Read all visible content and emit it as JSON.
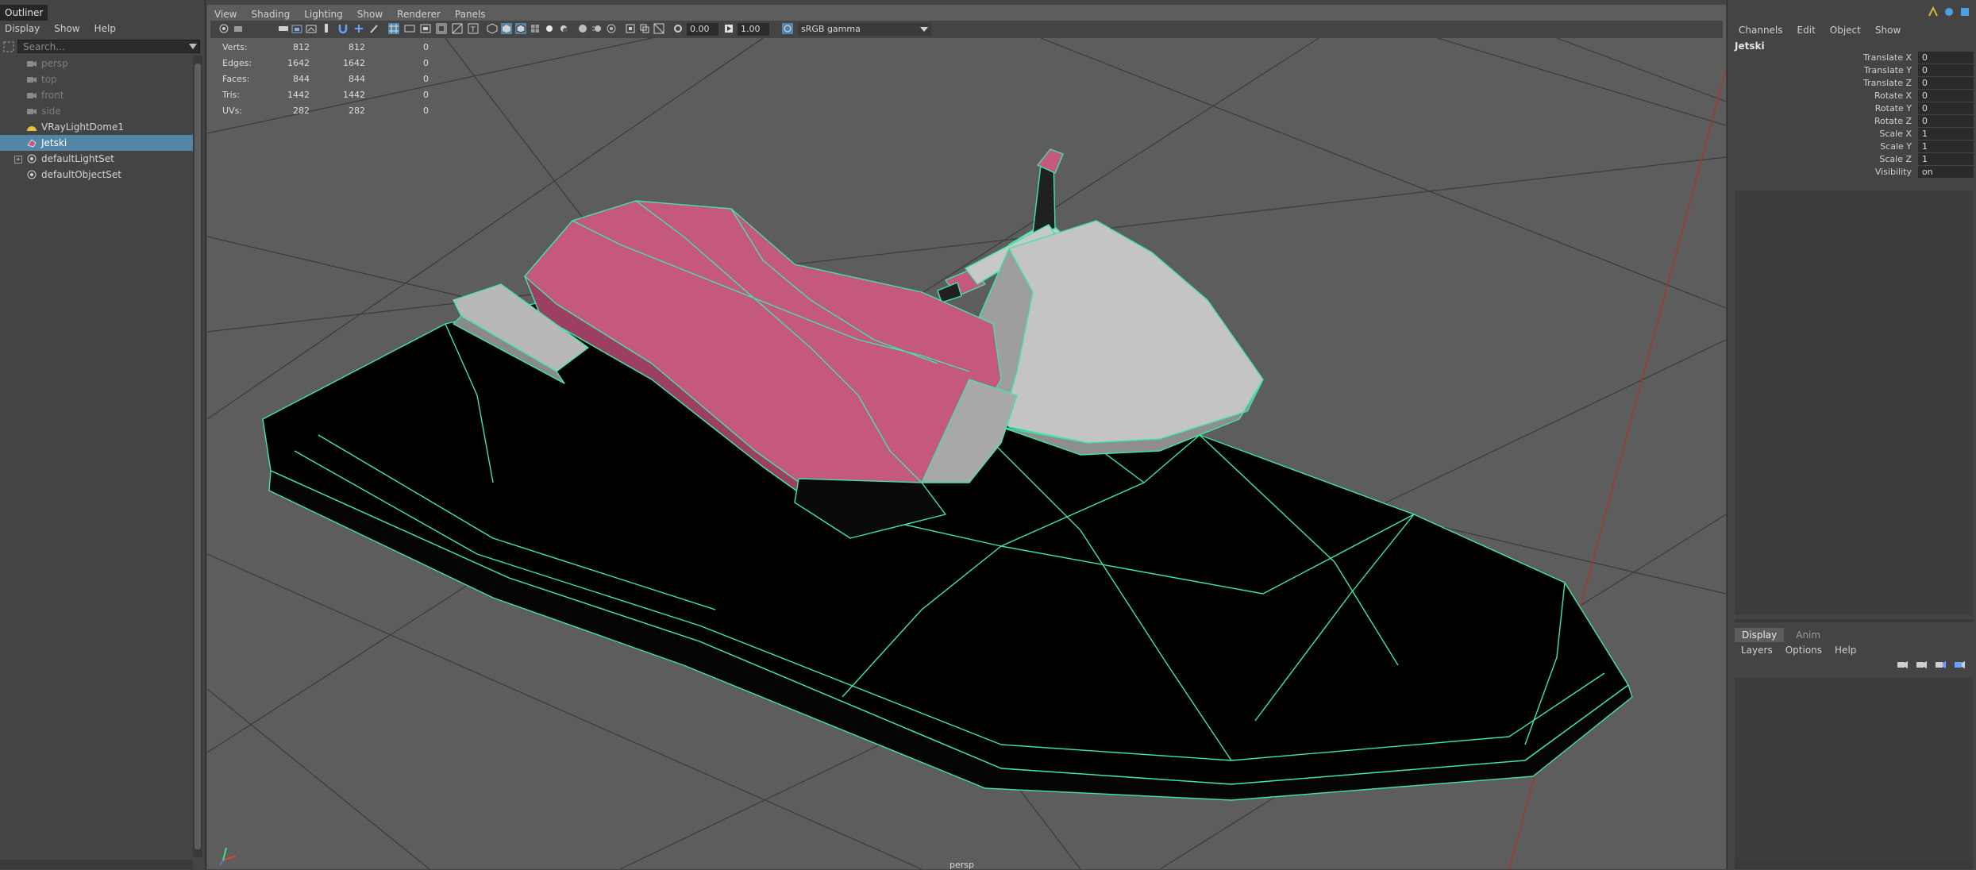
{
  "outliner": {
    "tab_title": "Outliner",
    "menu": [
      "Display",
      "Show",
      "Help"
    ],
    "search_placeholder": "Search...",
    "items": [
      {
        "label": "persp",
        "icon": "camera-icon",
        "dim": true,
        "selected": false
      },
      {
        "label": "top",
        "icon": "camera-icon",
        "dim": true,
        "selected": false
      },
      {
        "label": "front",
        "icon": "camera-icon",
        "dim": true,
        "selected": false
      },
      {
        "label": "side",
        "icon": "camera-icon",
        "dim": true,
        "selected": false
      },
      {
        "label": "VRayLightDome1",
        "icon": "dome-light-icon",
        "dim": false,
        "selected": false
      },
      {
        "label": "Jetski",
        "icon": "mesh-icon",
        "dim": false,
        "selected": true
      },
      {
        "label": "defaultLightSet",
        "icon": "set-icon",
        "dim": false,
        "selected": false,
        "expandable": true
      },
      {
        "label": "defaultObjectSet",
        "icon": "set-icon",
        "dim": false,
        "selected": false
      }
    ]
  },
  "viewport": {
    "menu": [
      "View",
      "Shading",
      "Lighting",
      "Show",
      "Renderer",
      "Panels"
    ],
    "toolbar": {
      "exposure": "0.00",
      "gamma": "1.00",
      "color_space": "sRGB gamma"
    },
    "hud": [
      {
        "label": "Verts:",
        "v1": "812",
        "v2": "812",
        "v3": "0"
      },
      {
        "label": "Edges:",
        "v1": "1642",
        "v2": "1642",
        "v3": "0"
      },
      {
        "label": "Faces:",
        "v1": "844",
        "v2": "844",
        "v3": "0"
      },
      {
        "label": "Tris:",
        "v1": "1442",
        "v2": "1442",
        "v3": "0"
      },
      {
        "label": "UVs:",
        "v1": "282",
        "v2": "282",
        "v3": "0"
      }
    ],
    "camera_label": "persp"
  },
  "channel_box": {
    "menu": [
      "Channels",
      "Edit",
      "Object",
      "Show"
    ],
    "object_name": "Jetski",
    "channels": [
      {
        "name": "Translate X",
        "value": "0"
      },
      {
        "name": "Translate Y",
        "value": "0"
      },
      {
        "name": "Translate Z",
        "value": "0"
      },
      {
        "name": "Rotate X",
        "value": "0"
      },
      {
        "name": "Rotate Y",
        "value": "0"
      },
      {
        "name": "Rotate Z",
        "value": "0"
      },
      {
        "name": "Scale X",
        "value": "1"
      },
      {
        "name": "Scale Y",
        "value": "1"
      },
      {
        "name": "Scale Z",
        "value": "1"
      },
      {
        "name": "Visibility",
        "value": "on"
      }
    ]
  },
  "layer_editor": {
    "tabs": [
      {
        "label": "Display",
        "active": true
      },
      {
        "label": "Anim",
        "active": false
      }
    ],
    "menu": [
      "Layers",
      "Options",
      "Help"
    ]
  },
  "colors": {
    "selection": "#5285a6",
    "wireframe": "#3fe6a5",
    "seat": "#c4587f",
    "viewport_bg": "#5d5d5d"
  }
}
